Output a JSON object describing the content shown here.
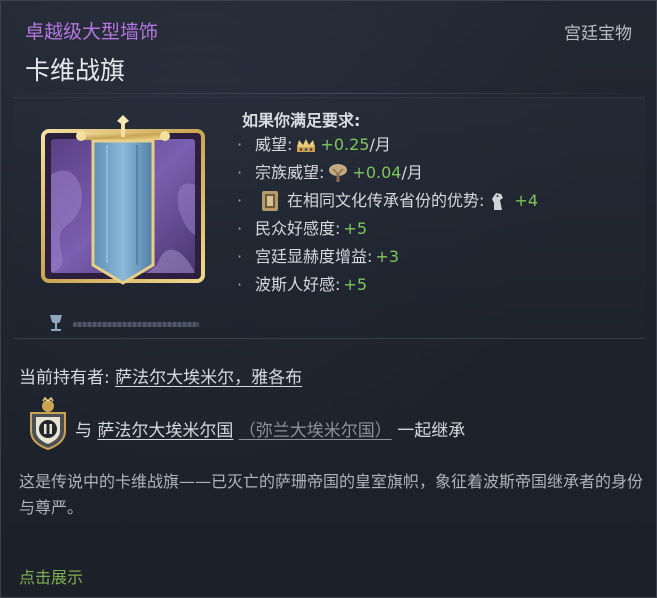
{
  "header": {
    "rarity": "卓越级大型墙饰",
    "category": "宫廷宝物",
    "title": "卡维战旗"
  },
  "requirements": {
    "title": "如果你满足要求:",
    "items": [
      {
        "label": "威望:",
        "icon": "crown-icon",
        "value": "+0.25",
        "suffix": "/月"
      },
      {
        "label": "宗族威望:",
        "icon": "tree-icon",
        "value": "+0.04",
        "suffix": "/月"
      },
      {
        "label": "在相同文化传承省份的优势:",
        "prefix_icon": "cultural-banner-icon",
        "icon": "horse-knight-icon",
        "value": "+4",
        "suffix": ""
      },
      {
        "label": "民众好感度:",
        "value": "+5",
        "suffix": ""
      },
      {
        "label": "宫廷显赫度增益:",
        "value": "+3",
        "suffix": ""
      },
      {
        "label": "波斯人好感:",
        "value": "+5",
        "suffix": ""
      }
    ]
  },
  "owner": {
    "label": "当前持有者:",
    "name": "萨法尔大埃米尔，雅各布"
  },
  "inheritance": {
    "prefix": "与",
    "dynasty": "萨法尔大埃米尔国",
    "realm": "（弥兰大埃米尔国）",
    "suffix": "一起继承"
  },
  "description": "这是传说中的卡维战旗——已灭亡的萨珊帝国的皇室旗帜，象征着波斯帝国继承者的身份与尊严。",
  "action": {
    "show_label": "点击展示"
  },
  "colors": {
    "rarity": "#b477e0",
    "positive": "#7fc45a",
    "link_green": "#7fae52",
    "background": "#1b2029"
  }
}
